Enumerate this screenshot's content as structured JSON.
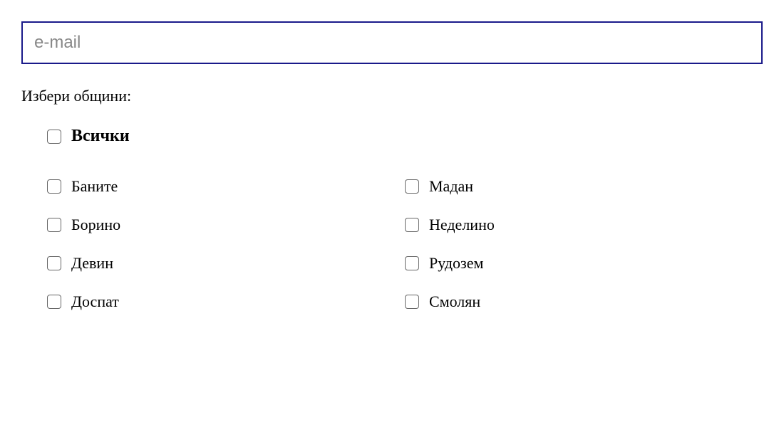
{
  "form": {
    "email_placeholder": "e-mail",
    "label": "Избери общини:",
    "all_label": "Всички",
    "left_column": [
      "Баните",
      "Борино",
      "Девин",
      "Доспат"
    ],
    "right_column": [
      "Мадан",
      "Неделино",
      "Рудозем",
      "Смолян"
    ]
  }
}
